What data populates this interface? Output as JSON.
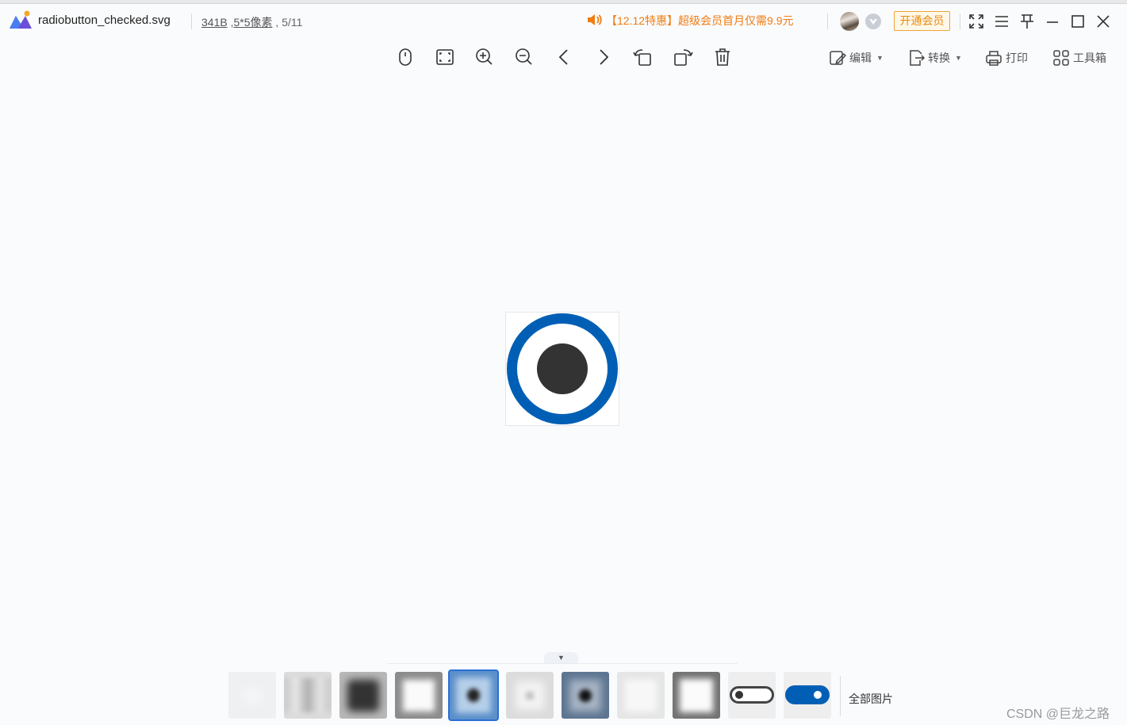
{
  "app": {
    "filename": "radiobutton_checked.svg",
    "file_size": "341B",
    "dimensions": "5*5像素",
    "position_index": "5/11"
  },
  "promo": {
    "text": "【12.12特惠】超级会员首月仅需9.9元"
  },
  "vip_button": {
    "label": "开通会员"
  },
  "toolbar_right": {
    "edit_label": "编辑",
    "convert_label": "转换",
    "print_label": "打印",
    "toolbox_label": "工具箱"
  },
  "thumbnail_strip": {
    "all_images_label": "全部图片",
    "selected_index": 4,
    "count": 11
  },
  "watermark": "CSDN @巨龙之路",
  "colors": {
    "accent_blue": "#005fb5",
    "dot_dark": "#333333",
    "promo_orange": "#f07d12",
    "selection_blue": "#2c6fd6"
  }
}
